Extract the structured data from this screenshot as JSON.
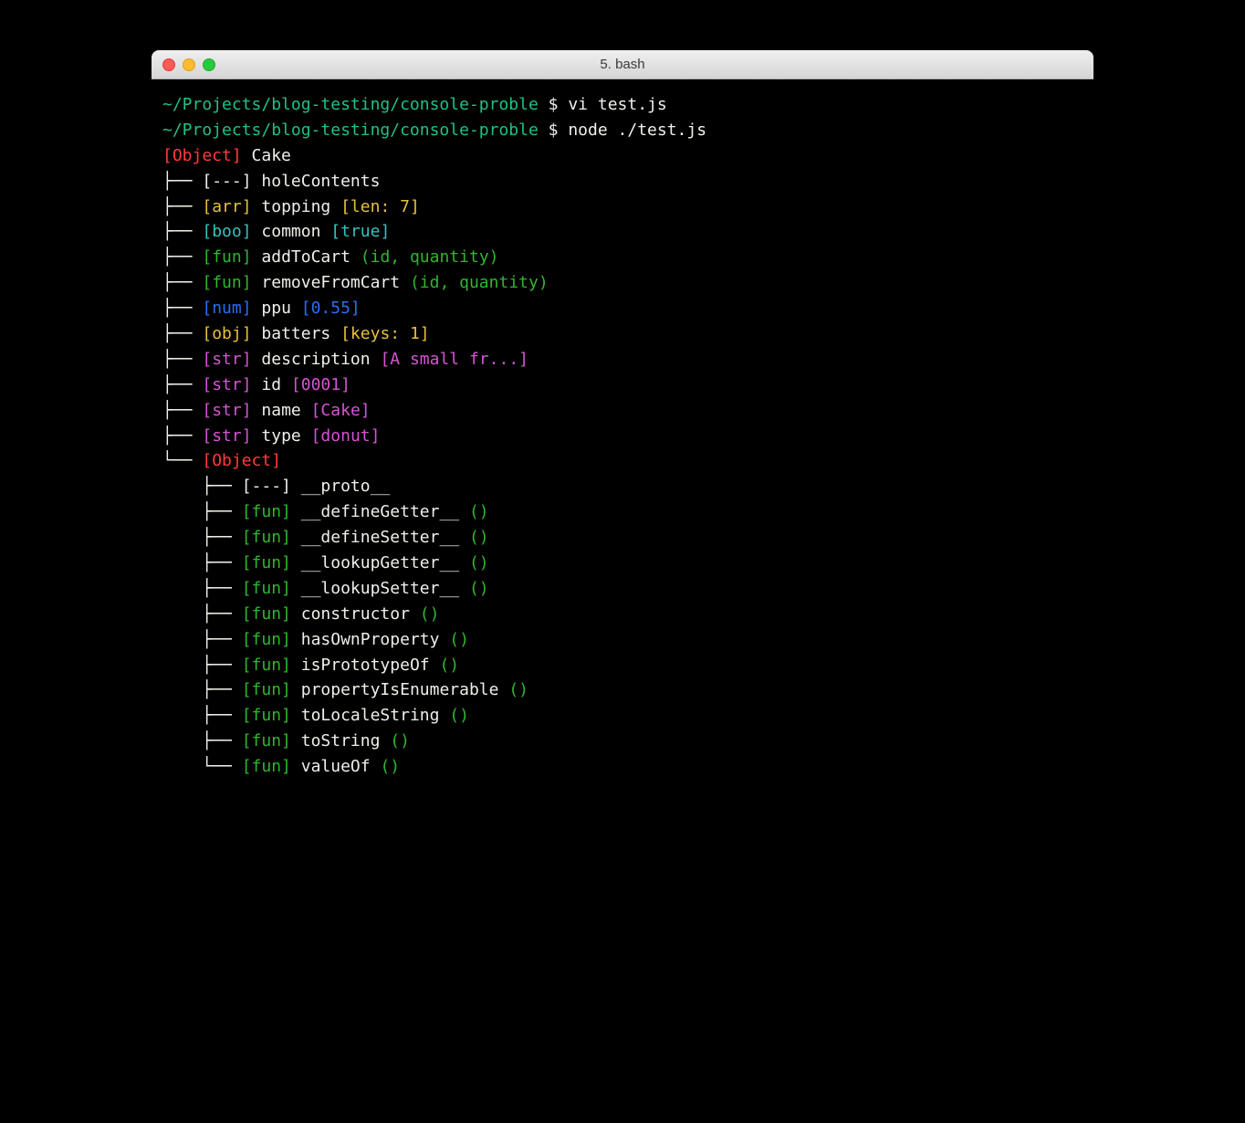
{
  "window": {
    "title": "5. bash"
  },
  "prompt": {
    "path": "~/Projects/blog-testing/console-proble",
    "symbol": "$"
  },
  "commands": [
    "vi test.js",
    "node ./test.js"
  ],
  "root": {
    "tag": "[Object]",
    "label": "Cake"
  },
  "rows": [
    {
      "prefix": "├── ",
      "tag": "[---]",
      "tagColor": "white",
      "name": "holeContents",
      "extra": "",
      "extraColor": ""
    },
    {
      "prefix": "├── ",
      "tag": "[arr]",
      "tagColor": "yellow",
      "name": "topping",
      "extra": "[len: 7]",
      "extraColor": "yellow"
    },
    {
      "prefix": "├── ",
      "tag": "[boo]",
      "tagColor": "cyan",
      "name": "common",
      "extra": "[true]",
      "extraColor": "cyan"
    },
    {
      "prefix": "├── ",
      "tag": "[fun]",
      "tagColor": "green",
      "name": "addToCart",
      "extra": "(id, quantity)",
      "extraColor": "green"
    },
    {
      "prefix": "├── ",
      "tag": "[fun]",
      "tagColor": "green",
      "name": "removeFromCart",
      "extra": "(id, quantity)",
      "extraColor": "green"
    },
    {
      "prefix": "├── ",
      "tag": "[num]",
      "tagColor": "blue",
      "name": "ppu",
      "extra": "[0.55]",
      "extraColor": "blue"
    },
    {
      "prefix": "├── ",
      "tag": "[obj]",
      "tagColor": "yellow",
      "name": "batters",
      "extra": "[keys: 1]",
      "extraColor": "yellow"
    },
    {
      "prefix": "├── ",
      "tag": "[str]",
      "tagColor": "magenta",
      "name": "description",
      "extra": "[A small fr...]",
      "extraColor": "magenta"
    },
    {
      "prefix": "├── ",
      "tag": "[str]",
      "tagColor": "magenta",
      "name": "id",
      "extra": "[0001]",
      "extraColor": "magenta"
    },
    {
      "prefix": "├── ",
      "tag": "[str]",
      "tagColor": "magenta",
      "name": "name",
      "extra": "[Cake]",
      "extraColor": "magenta"
    },
    {
      "prefix": "├── ",
      "tag": "[str]",
      "tagColor": "magenta",
      "name": "type",
      "extra": "[donut]",
      "extraColor": "magenta"
    }
  ],
  "protoHeader": {
    "prefix": "└── ",
    "tag": "[Object]"
  },
  "protoRows": [
    {
      "prefix": "    ├── ",
      "tag": "[---]",
      "tagColor": "white",
      "name": "__proto__",
      "extra": "",
      "extraColor": ""
    },
    {
      "prefix": "    ├── ",
      "tag": "[fun]",
      "tagColor": "green",
      "name": "__defineGetter__",
      "extra": "()",
      "extraColor": "green"
    },
    {
      "prefix": "    ├── ",
      "tag": "[fun]",
      "tagColor": "green",
      "name": "__defineSetter__",
      "extra": "()",
      "extraColor": "green"
    },
    {
      "prefix": "    ├── ",
      "tag": "[fun]",
      "tagColor": "green",
      "name": "__lookupGetter__",
      "extra": "()",
      "extraColor": "green"
    },
    {
      "prefix": "    ├── ",
      "tag": "[fun]",
      "tagColor": "green",
      "name": "__lookupSetter__",
      "extra": "()",
      "extraColor": "green"
    },
    {
      "prefix": "    ├── ",
      "tag": "[fun]",
      "tagColor": "green",
      "name": "constructor",
      "extra": "()",
      "extraColor": "green"
    },
    {
      "prefix": "    ├── ",
      "tag": "[fun]",
      "tagColor": "green",
      "name": "hasOwnProperty",
      "extra": "()",
      "extraColor": "green"
    },
    {
      "prefix": "    ├── ",
      "tag": "[fun]",
      "tagColor": "green",
      "name": "isPrototypeOf",
      "extra": "()",
      "extraColor": "green"
    },
    {
      "prefix": "    ├── ",
      "tag": "[fun]",
      "tagColor": "green",
      "name": "propertyIsEnumerable",
      "extra": "()",
      "extraColor": "green"
    },
    {
      "prefix": "    ├── ",
      "tag": "[fun]",
      "tagColor": "green",
      "name": "toLocaleString",
      "extra": "()",
      "extraColor": "green"
    },
    {
      "prefix": "    ├── ",
      "tag": "[fun]",
      "tagColor": "green",
      "name": "toString",
      "extra": "()",
      "extraColor": "green"
    },
    {
      "prefix": "    └── ",
      "tag": "[fun]",
      "tagColor": "green",
      "name": "valueOf",
      "extra": "()",
      "extraColor": "green"
    }
  ]
}
